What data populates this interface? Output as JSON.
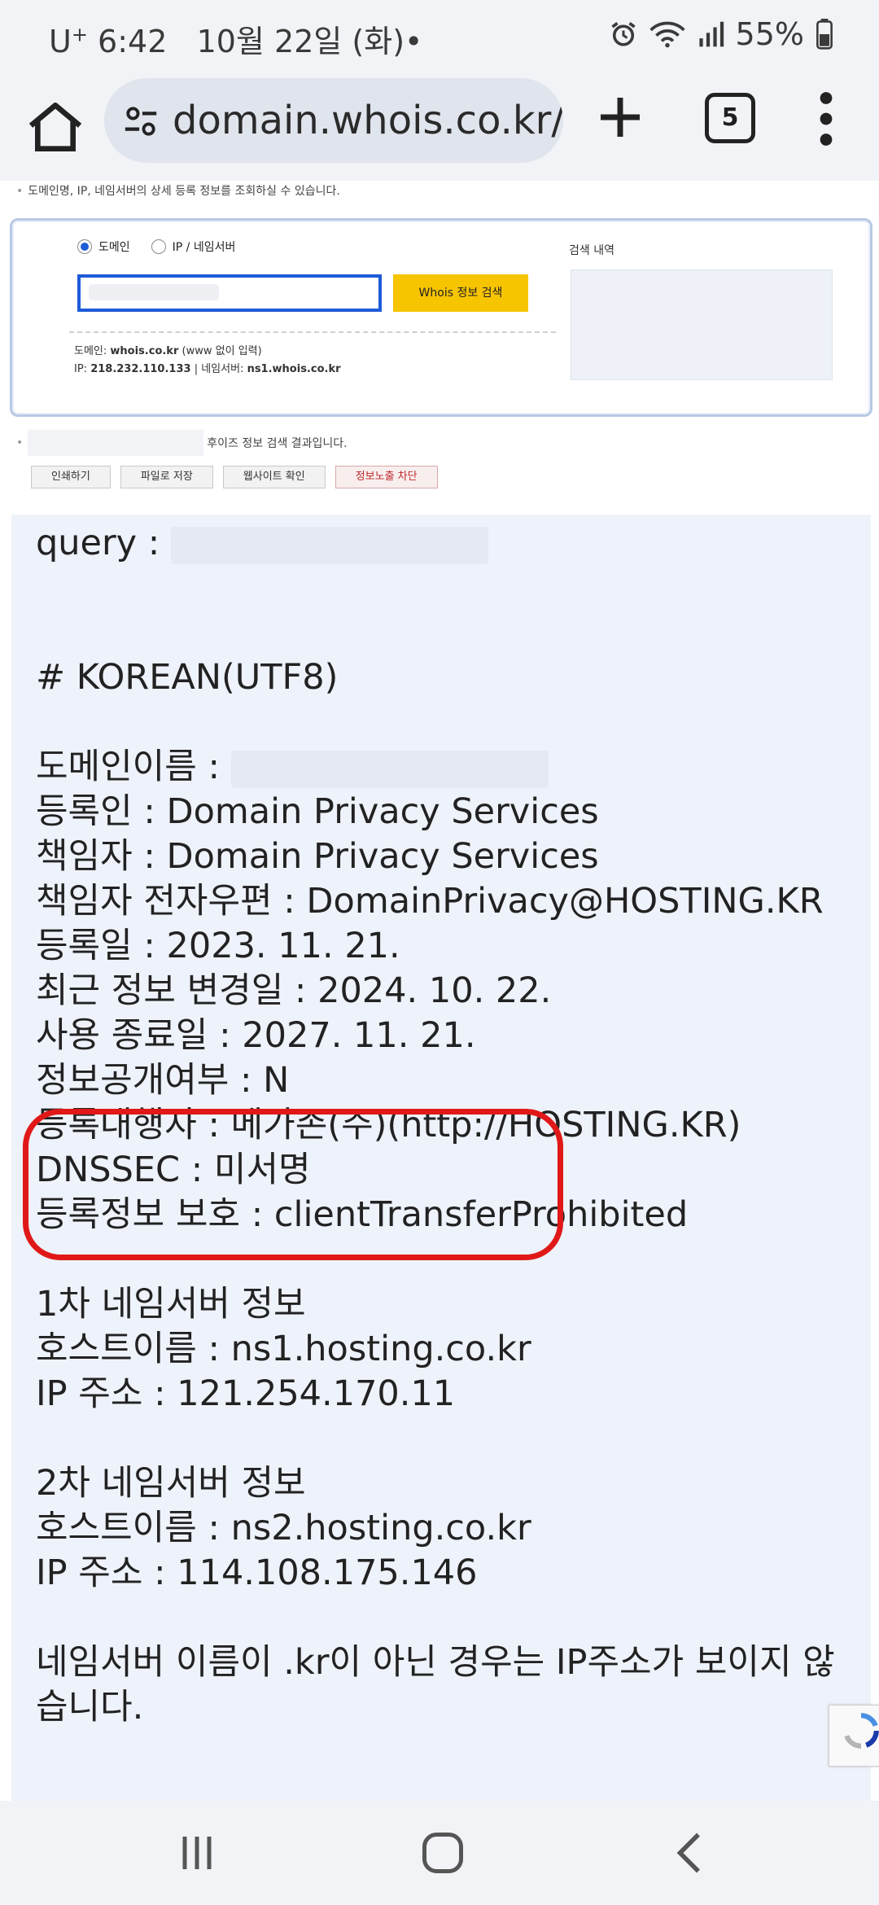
{
  "status_bar": {
    "carrier": "U",
    "carrier_sup": "+",
    "time": "6:42",
    "date": "10월 22일 (화)",
    "dot": "•",
    "battery": "55%"
  },
  "browser": {
    "url": "domain.whois.co.kr/w",
    "tab_count": "5"
  },
  "page": {
    "intro": "도메인명, IP, 네임서버의 상세 등록 정보를 조회하실 수 있습니다.",
    "search": {
      "radio_domain": "도메인",
      "radio_ip": "IP / 네임서버",
      "button": "Whois 정보 검색",
      "hint_domain_label": "도메인: ",
      "hint_domain_value": "whois.co.kr",
      "hint_domain_note": " (www 없이 입력)",
      "hint_ip_label": "IP: ",
      "hint_ip_value": "218.232.110.133",
      "hint_ns_label": " | 네임서버: ",
      "hint_ns_value": "ns1.whois.co.kr",
      "history_label": "검색 내역"
    },
    "result_text": "후이즈 정보 검색 결과입니다.",
    "actions": [
      "인쇄하기",
      "파일로 저장",
      "웹사이트 확인",
      "정보노출 차단"
    ],
    "whois": {
      "query": "query :",
      "header": "# KOREAN(UTF8)",
      "domain_name": "도메인이름 :",
      "registrant": "등록인 : Domain Privacy Services",
      "admin": "책임자 : Domain Privacy Services",
      "admin_email": "책임자 전자우편 : DomainPrivacy@HOSTING.KR",
      "reg_date": "등록일 : 2023. 11. 21.",
      "updated": "최근 정보 변경일 : 2024. 10. 22.",
      "expires": "사용 종료일 : 2027. 11. 21.",
      "publish": "정보공개여부 : N",
      "registrar": "등록대행자 : 메가존(주)(http://HOSTING.KR)",
      "dnssec": "DNSSEC : 미서명",
      "status": "등록정보 보호 : clientTransferProhibited",
      "ns1_title": "1차 네임서버 정보",
      "ns1_host": "호스트이름 : ns1.hosting.co.kr",
      "ns1_ip": "IP 주소 : 121.254.170.11",
      "ns2_title": "2차 네임서버 정보",
      "ns2_host": "호스트이름 : ns2.hosting.co.kr",
      "ns2_ip": "IP 주소 : 114.108.175.146",
      "note": "네임서버 이름이 .kr이 아닌 경우는 IP주소가 보이지 않습니다."
    }
  },
  "colors": {
    "highlight": "#e01818",
    "search_button": "#f7c400",
    "input_border": "#1e5bd8",
    "whois_bg": "#eef2fa"
  },
  "icons": [
    "home-icon",
    "tune-icon",
    "plus-icon",
    "tabs-icon",
    "more-vert-icon",
    "alarm-icon",
    "wifi-icon",
    "signal-icon",
    "battery-icon",
    "recents-icon",
    "home-nav-icon",
    "back-icon"
  ]
}
